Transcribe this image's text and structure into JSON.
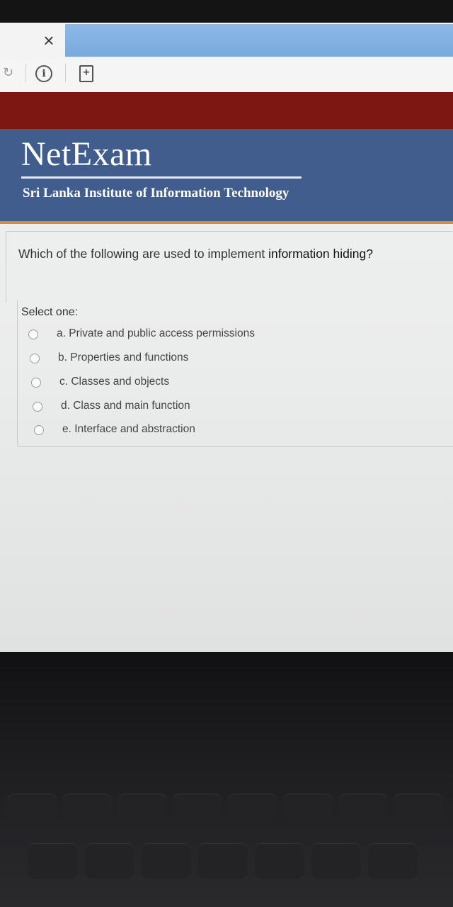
{
  "browser": {
    "close_glyph": "×",
    "info_glyph": "i",
    "page_glyph": "+",
    "reload_glyph": "↻"
  },
  "site": {
    "logo_text": "NetExam",
    "institute": "Sri Lanka Institute of Information Technology",
    "colors": {
      "red_band": "#7d1712",
      "blue_band": "#415d8e",
      "accent_rule": "#d58a3d"
    }
  },
  "question": {
    "text_part1": "Which of the following are used to implement ",
    "text_part2": "information hiding?",
    "select_label": "Select one:",
    "options": [
      {
        "label": "a. Private and public access permissions",
        "selected": false
      },
      {
        "label": "b. Properties and functions",
        "selected": false
      },
      {
        "label": "c. Classes and objects",
        "selected": false
      },
      {
        "label": "d. Class and main function",
        "selected": false
      },
      {
        "label": "e. Interface and abstraction",
        "selected": false
      }
    ]
  }
}
